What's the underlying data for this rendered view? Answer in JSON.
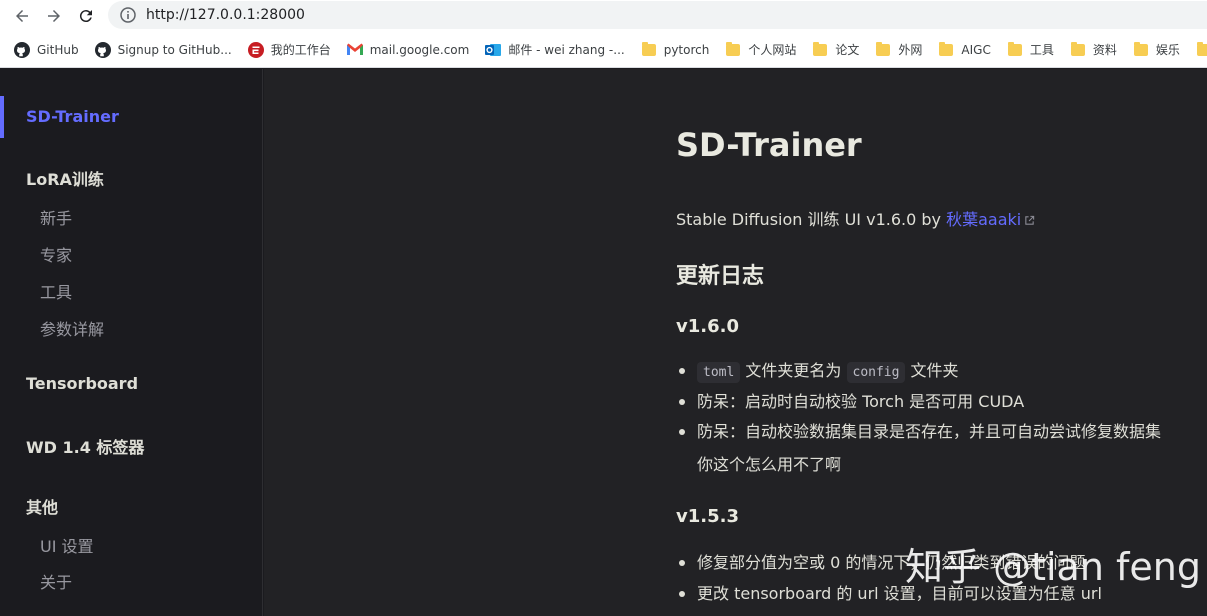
{
  "browser": {
    "url": "http://127.0.0.1:28000",
    "bookmarks": [
      {
        "label": "GitHub",
        "icon": "github-icon"
      },
      {
        "label": "Signup to GitHub...",
        "icon": "github-icon"
      },
      {
        "label": "我的工作台",
        "icon": "gitee-icon"
      },
      {
        "label": "mail.google.com",
        "icon": "gmail-icon"
      },
      {
        "label": "邮件 - wei zhang -...",
        "icon": "outlook-icon"
      },
      {
        "label": "pytorch",
        "icon": "folder-icon"
      },
      {
        "label": "个人网站",
        "icon": "folder-icon"
      },
      {
        "label": "论文",
        "icon": "folder-icon"
      },
      {
        "label": "外网",
        "icon": "folder-icon"
      },
      {
        "label": "AIGC",
        "icon": "folder-icon"
      },
      {
        "label": "工具",
        "icon": "folder-icon"
      },
      {
        "label": "资料",
        "icon": "folder-icon"
      },
      {
        "label": "娱乐",
        "icon": "folder-icon"
      }
    ]
  },
  "sidebar": {
    "title": "SD-Trainer",
    "groups": [
      {
        "label": "LoRA训练",
        "items": [
          "新手",
          "专家",
          "工具",
          "参数详解"
        ]
      },
      {
        "label": "Tensorboard",
        "items": []
      },
      {
        "label": "WD 1.4 标签器",
        "items": []
      },
      {
        "label": "其他",
        "items": [
          "UI 设置",
          "关于"
        ]
      }
    ]
  },
  "content": {
    "title": "SD-Trainer",
    "intro_text": "Stable Diffusion 训练 UI v1.6.0 by ",
    "intro_link": "秋葉aaaki",
    "changelog_heading": "更新日志",
    "versions": [
      {
        "version": "v1.6.0",
        "item1_code_a": "toml",
        "item1_text_a": " 文件夹更名为 ",
        "item1_code_b": "config",
        "item1_text_b": " 文件夹",
        "item2": "防呆：启动时自动校验 Torch 是否可用 CUDA",
        "item3_line1": "防呆：自动校验数据集目录是否存在，并且可自动尝试修复数据集",
        "item3_line2": "你这个怎么用不了啊"
      },
      {
        "version": "v1.5.3",
        "item1": "修复部分值为空或 0 的情况下，仍然归类到错误的问题",
        "item2": "更改 tensorboard 的 url 设置，目前可以设置为任意 url"
      }
    ]
  },
  "watermark": "知乎 @tian feng",
  "colors": {
    "accent": "#646cff",
    "sidebar_bg": "#1b1b1f",
    "main_bg": "#222225"
  }
}
